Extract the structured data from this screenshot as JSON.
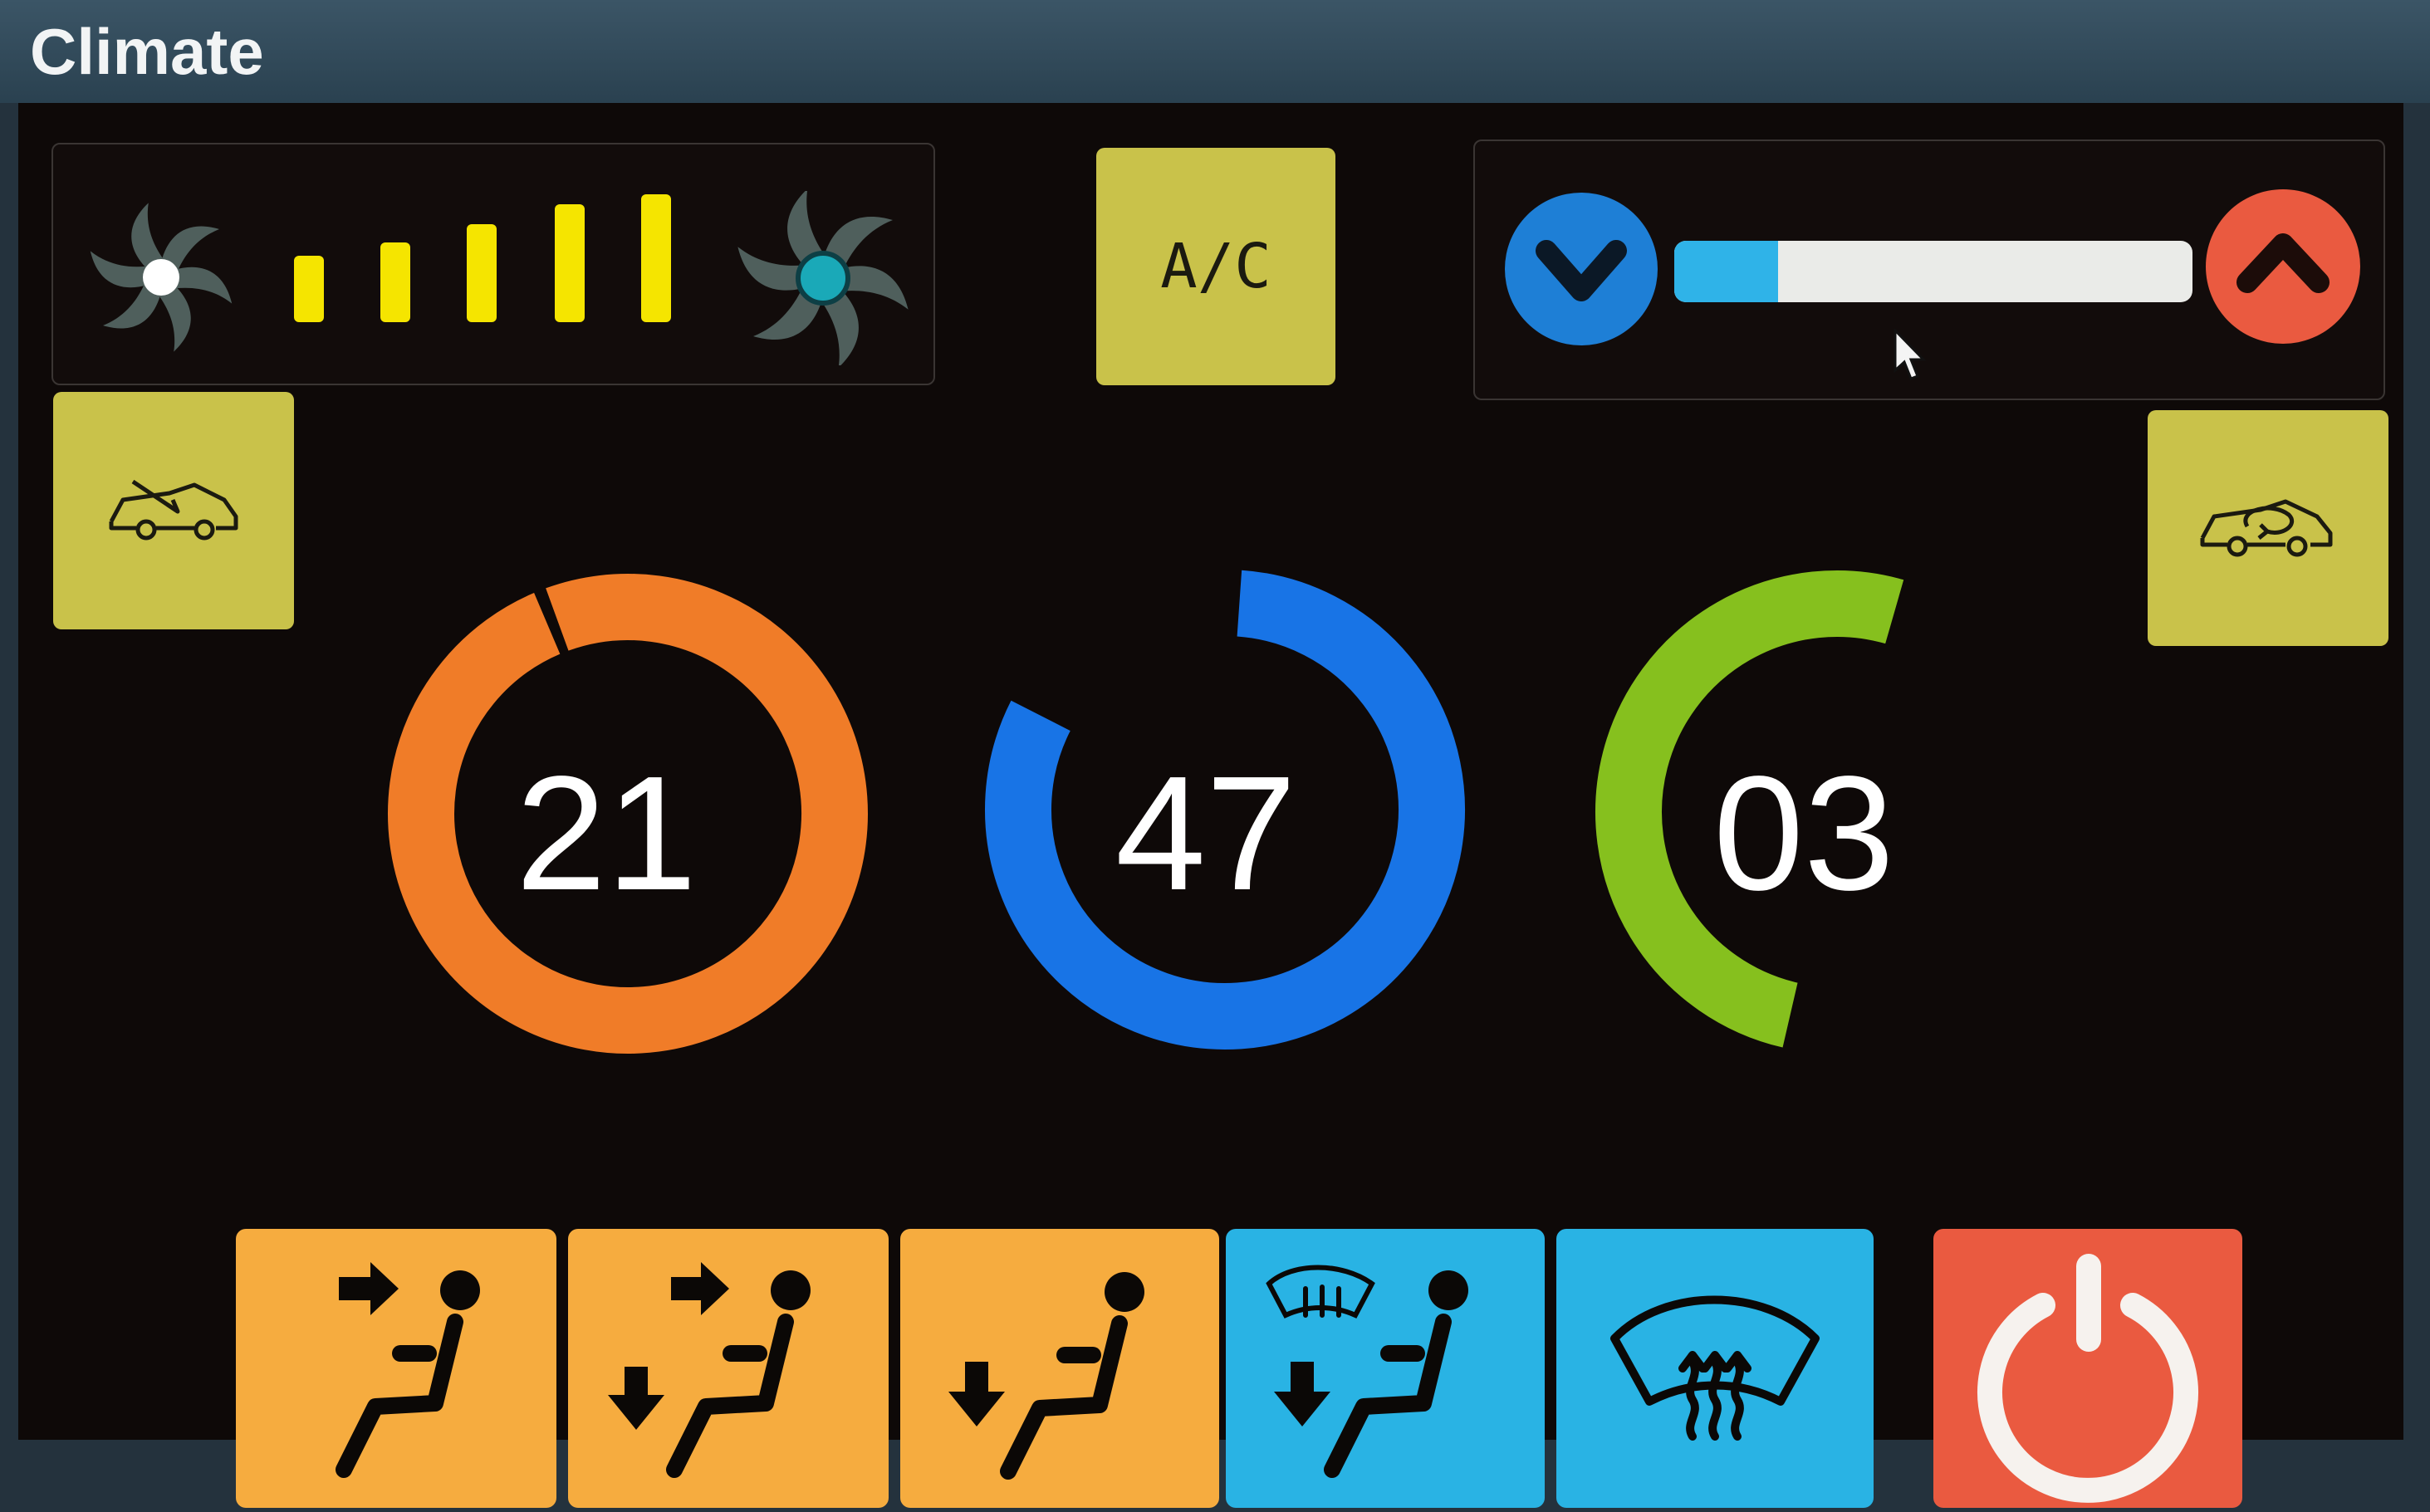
{
  "window": {
    "title": "Climate"
  },
  "fan": {
    "level": 5,
    "max": 5,
    "bar_color": "#f5e500"
  },
  "ac_button": {
    "label": "A/C"
  },
  "temperature_slider": {
    "value": 0.2,
    "fill_color": "#2fb3e8"
  },
  "gauges": [
    {
      "value": "21",
      "color": "#f07c28"
    },
    {
      "value": "47",
      "color": "#1874e6"
    },
    {
      "value": "03",
      "color": "#86c01e"
    }
  ],
  "colors": {
    "tile_yellow": "#c9c24a",
    "airflow_orange": "#f6ac3f",
    "defrost_blue": "#29b3e4",
    "power_red": "#ea5a40",
    "down_button": "#1e7fd6",
    "up_button": "#ea5a40"
  },
  "icons": {
    "fan_low": "fan-low-icon",
    "fan_high": "fan-high-icon",
    "fresh_air": "fresh-air-icon",
    "recirculate": "recirculate-icon",
    "chevron_down": "chevron-down-icon",
    "chevron_up": "chevron-up-icon",
    "power": "power-icon"
  }
}
